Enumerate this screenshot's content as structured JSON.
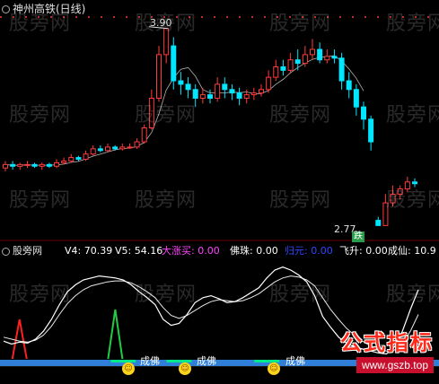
{
  "top_panel": {
    "title": "神州高铁(日线)",
    "high_price": "3.90",
    "low_price": "2.77",
    "drop_tag": "跌",
    "colors": {
      "up": "#ff3b3b",
      "down": "#00e6ff",
      "ma": "#ffffff",
      "tag_bg": "#2a9d4b"
    },
    "candles": [
      {
        "o": 3.1,
        "c": 3.12,
        "h": 3.14,
        "l": 3.08
      },
      {
        "o": 3.12,
        "c": 3.11,
        "h": 3.14,
        "l": 3.09
      },
      {
        "o": 3.11,
        "c": 3.12,
        "h": 3.13,
        "l": 3.09
      },
      {
        "o": 3.12,
        "c": 3.12,
        "h": 3.14,
        "l": 3.1
      },
      {
        "o": 3.12,
        "c": 3.11,
        "h": 3.13,
        "l": 3.1
      },
      {
        "o": 3.11,
        "c": 3.12,
        "h": 3.13,
        "l": 3.09
      },
      {
        "o": 3.12,
        "c": 3.11,
        "h": 3.13,
        "l": 3.1
      },
      {
        "o": 3.11,
        "c": 3.13,
        "h": 3.15,
        "l": 3.1
      },
      {
        "o": 3.13,
        "c": 3.14,
        "h": 3.16,
        "l": 3.12
      },
      {
        "o": 3.14,
        "c": 3.16,
        "h": 3.18,
        "l": 3.13
      },
      {
        "o": 3.16,
        "c": 3.15,
        "h": 3.17,
        "l": 3.14
      },
      {
        "o": 3.15,
        "c": 3.18,
        "h": 3.2,
        "l": 3.14
      },
      {
        "o": 3.18,
        "c": 3.21,
        "h": 3.23,
        "l": 3.17
      },
      {
        "o": 3.21,
        "c": 3.2,
        "h": 3.23,
        "l": 3.19
      },
      {
        "o": 3.2,
        "c": 3.22,
        "h": 3.24,
        "l": 3.19
      },
      {
        "o": 3.22,
        "c": 3.21,
        "h": 3.23,
        "l": 3.2
      },
      {
        "o": 3.21,
        "c": 3.22,
        "h": 3.24,
        "l": 3.2
      },
      {
        "o": 3.22,
        "c": 3.22,
        "h": 3.24,
        "l": 3.21
      },
      {
        "o": 3.22,
        "c": 3.25,
        "h": 3.27,
        "l": 3.21
      },
      {
        "o": 3.25,
        "c": 3.33,
        "h": 3.35,
        "l": 3.24
      },
      {
        "o": 3.33,
        "c": 3.5,
        "h": 3.55,
        "l": 3.32
      },
      {
        "o": 3.5,
        "c": 3.75,
        "h": 3.8,
        "l": 3.48
      },
      {
        "o": 3.75,
        "c": 3.9,
        "h": 3.9,
        "l": 3.7
      },
      {
        "o": 3.8,
        "c": 3.6,
        "h": 3.85,
        "l": 3.55
      },
      {
        "o": 3.6,
        "c": 3.58,
        "h": 3.65,
        "l": 3.52
      },
      {
        "o": 3.58,
        "c": 3.55,
        "h": 3.62,
        "l": 3.5
      },
      {
        "o": 3.55,
        "c": 3.5,
        "h": 3.58,
        "l": 3.45
      },
      {
        "o": 3.5,
        "c": 3.52,
        "h": 3.56,
        "l": 3.47
      },
      {
        "o": 3.52,
        "c": 3.5,
        "h": 3.55,
        "l": 3.47
      },
      {
        "o": 3.5,
        "c": 3.58,
        "h": 3.62,
        "l": 3.48
      },
      {
        "o": 3.58,
        "c": 3.55,
        "h": 3.62,
        "l": 3.5
      },
      {
        "o": 3.55,
        "c": 3.53,
        "h": 3.58,
        "l": 3.49
      },
      {
        "o": 3.53,
        "c": 3.5,
        "h": 3.56,
        "l": 3.46
      },
      {
        "o": 3.5,
        "c": 3.52,
        "h": 3.55,
        "l": 3.47
      },
      {
        "o": 3.52,
        "c": 3.53,
        "h": 3.56,
        "l": 3.49
      },
      {
        "o": 3.53,
        "c": 3.55,
        "h": 3.58,
        "l": 3.51
      },
      {
        "o": 3.55,
        "c": 3.62,
        "h": 3.66,
        "l": 3.53
      },
      {
        "o": 3.62,
        "c": 3.68,
        "h": 3.72,
        "l": 3.6
      },
      {
        "o": 3.68,
        "c": 3.66,
        "h": 3.72,
        "l": 3.63
      },
      {
        "o": 3.66,
        "c": 3.72,
        "h": 3.76,
        "l": 3.64
      },
      {
        "o": 3.72,
        "c": 3.7,
        "h": 3.78,
        "l": 3.66
      },
      {
        "o": 3.7,
        "c": 3.75,
        "h": 3.8,
        "l": 3.68
      },
      {
        "o": 3.75,
        "c": 3.78,
        "h": 3.84,
        "l": 3.72
      },
      {
        "o": 3.78,
        "c": 3.72,
        "h": 3.82,
        "l": 3.7
      },
      {
        "o": 3.72,
        "c": 3.74,
        "h": 3.78,
        "l": 3.7
      },
      {
        "o": 3.74,
        "c": 3.73,
        "h": 3.78,
        "l": 3.7
      },
      {
        "o": 3.73,
        "c": 3.6,
        "h": 3.76,
        "l": 3.55
      },
      {
        "o": 3.6,
        "c": 3.55,
        "h": 3.65,
        "l": 3.5
      },
      {
        "o": 3.55,
        "c": 3.45,
        "h": 3.58,
        "l": 3.4
      },
      {
        "o": 3.45,
        "c": 3.38,
        "h": 3.48,
        "l": 3.32
      },
      {
        "o": 3.38,
        "c": 3.25,
        "h": 3.4,
        "l": 3.2
      },
      {
        "o": 2.8,
        "c": 2.77,
        "h": 2.82,
        "l": 2.77
      },
      {
        "o": 2.77,
        "c": 2.9,
        "h": 2.95,
        "l": 2.77
      },
      {
        "o": 2.9,
        "c": 2.95,
        "h": 3.0,
        "l": 2.88
      },
      {
        "o": 2.95,
        "c": 2.98,
        "h": 3.0,
        "l": 2.92
      },
      {
        "o": 2.98,
        "c": 3.02,
        "h": 3.05,
        "l": 2.96
      },
      {
        "o": 3.02,
        "c": 3.01,
        "h": 3.04,
        "l": 2.99
      }
    ]
  },
  "indicator_panel": {
    "name": "股旁网",
    "v4_label": "V4: 70.39",
    "v5_label": "V5: 54.16",
    "dazhang_label": "大涨买: 0.00",
    "fozhu_label": "佛珠: 0.00",
    "hidden_label": "归元: 0.00",
    "feisheng_label": "飞升: 0.00",
    "chengxian_label": "成仙: 10.9",
    "signal_label": "成佛",
    "colors": {
      "v4": "#ffffff",
      "v5": "#e8e8e8",
      "dazhang": "#ff44ff",
      "hidden": "#3344ff",
      "red_peak": "#ff2020",
      "green_peak": "#22cc44",
      "band": "#2f7fd8"
    },
    "v4": [
      18,
      15,
      17,
      16,
      20,
      28,
      40,
      55,
      68,
      75,
      80,
      82,
      84,
      83,
      82,
      80,
      75,
      68,
      62,
      55,
      40,
      34,
      36,
      45,
      57,
      62,
      64,
      61,
      57,
      58,
      62,
      67,
      72,
      82,
      90,
      93,
      90,
      85,
      78,
      64,
      43,
      32,
      22,
      16,
      12,
      10,
      8,
      6,
      5,
      12,
      28,
      50,
      70
    ],
    "v5": [
      22,
      20,
      18,
      17,
      19,
      24,
      33,
      45,
      56,
      64,
      70,
      74,
      76,
      78,
      79,
      79,
      77,
      73,
      68,
      62,
      52,
      44,
      41,
      44,
      49,
      54,
      58,
      60,
      59,
      58,
      59,
      62,
      66,
      72,
      78,
      82,
      84,
      83,
      80,
      74,
      62,
      50,
      40,
      31,
      24,
      18,
      13,
      10,
      8,
      9,
      15,
      28,
      45
    ],
    "red_peak_at": 2,
    "green_peak_at": 14,
    "signal_positions": [
      15,
      22,
      33
    ],
    "footer_emoji": "☺"
  },
  "watermark": "股旁网",
  "brand": {
    "title": "公式指标",
    "url": "www.gszb.top"
  }
}
